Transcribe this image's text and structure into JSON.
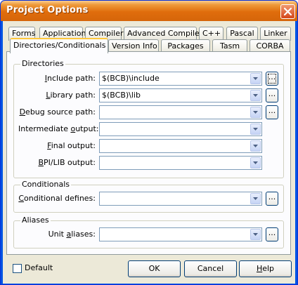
{
  "window": {
    "title": "Project Options"
  },
  "tabs_row1": [
    "Forms",
    "Application",
    "Compiler",
    "Advanced Compiler",
    "C++",
    "Pascal",
    "Linker"
  ],
  "tabs_row2": [
    "Directories/Conditionals",
    "Version Info",
    "Packages",
    "Tasm",
    "CORBA"
  ],
  "selected_tab": "Directories/Conditionals",
  "directories": {
    "group_label": "Directories",
    "include_path": {
      "label_pre": "",
      "label_u": "I",
      "label_post": "nclude path:",
      "value": "$(BCB)\\include"
    },
    "library_path": {
      "label_pre": "",
      "label_u": "L",
      "label_post": "ibrary path:",
      "value": "$(BCB)\\lib"
    },
    "debug_source_path": {
      "label_pre": "",
      "label_u": "D",
      "label_post": "ebug source path:",
      "value": ""
    },
    "intermediate_output": {
      "label_pre": "Intermediate ",
      "label_u": "o",
      "label_post": "utput:",
      "value": ""
    },
    "final_output": {
      "label_pre": "",
      "label_u": "F",
      "label_post": "inal output:",
      "value": ""
    },
    "bpi_lib_output": {
      "label_pre": "",
      "label_u": "B",
      "label_post": "PI/LIB output:",
      "value": ""
    }
  },
  "conditionals": {
    "group_label": "Conditionals",
    "defines": {
      "label_pre": "",
      "label_u": "C",
      "label_post": "onditional defines:",
      "value": ""
    }
  },
  "aliases": {
    "group_label": "Aliases",
    "unit_aliases": {
      "label_pre": "Unit ",
      "label_u": "a",
      "label_post": "liases:",
      "value": ""
    }
  },
  "ellipsis_label": "...",
  "footer": {
    "default_label": "Default",
    "default_checked": false,
    "ok_label": "OK",
    "cancel_label": "Cancel",
    "help_label_u": "H",
    "help_label_rest": "elp"
  },
  "colors": {
    "titlebar": "#e06d0c",
    "client": "#ece9d8",
    "panel": "#fcfcfe",
    "tab_highlight": "#ffc83c"
  }
}
